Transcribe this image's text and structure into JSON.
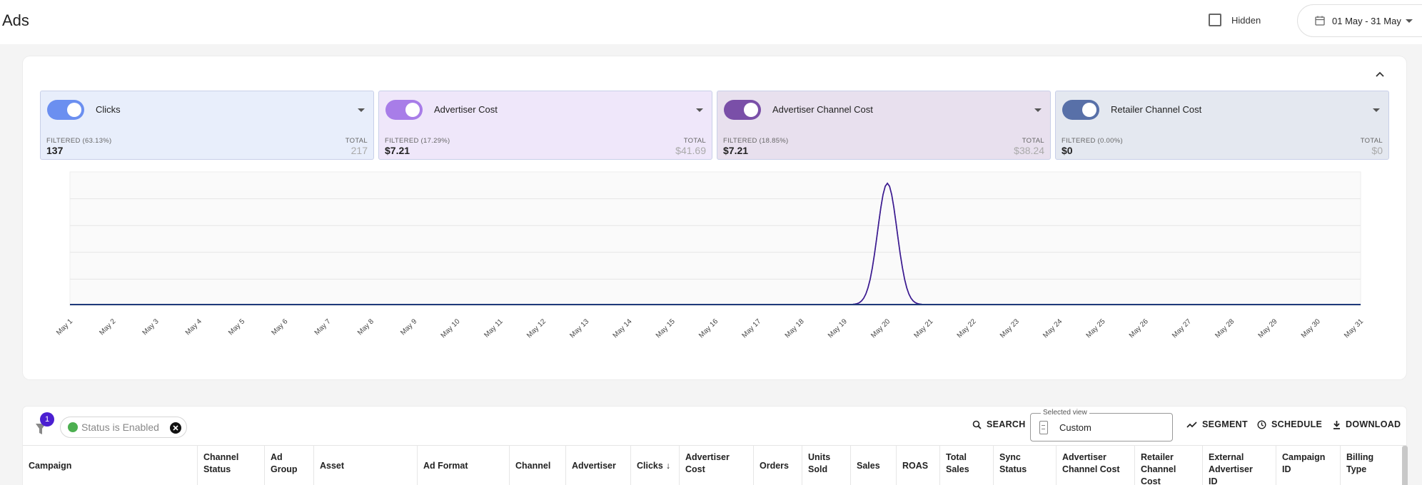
{
  "header": {
    "title": "Ads",
    "hidden_label": "Hidden",
    "date_range": "01 May - 31 May"
  },
  "metrics": [
    {
      "name": "Clicks",
      "filtered_label": "FILTERED (63.13%)",
      "filtered_value": "137",
      "total_label": "TOTAL",
      "total_value": "217",
      "color": "#6b8ff0",
      "bg": "#e8eefb"
    },
    {
      "name": "Advertiser Cost",
      "filtered_label": "FILTERED (17.29%)",
      "filtered_value": "$7.21",
      "total_label": "TOTAL",
      "total_value": "$41.69",
      "color": "#a87de8",
      "bg": "#efe7fa"
    },
    {
      "name": "Advertiser Channel Cost",
      "filtered_label": "FILTERED (18.85%)",
      "filtered_value": "$7.21",
      "total_label": "TOTAL",
      "total_value": "$38.24",
      "color": "#7a4fa8",
      "bg": "#e8e0ee"
    },
    {
      "name": "Retailer Channel Cost",
      "filtered_label": "FILTERED (0.00%)",
      "filtered_value": "$0",
      "total_label": "TOTAL",
      "total_value": "$0",
      "color": "#5870a8",
      "bg": "#e4e8f0"
    }
  ],
  "chart_data": {
    "type": "line",
    "title": "",
    "xlabel": "",
    "ylabel": "",
    "grid": true,
    "categories": [
      "May 1",
      "May 2",
      "May 3",
      "May 4",
      "May 5",
      "May 6",
      "May 7",
      "May 8",
      "May 9",
      "May 10",
      "May 11",
      "May 12",
      "May 13",
      "May 14",
      "May 15",
      "May 16",
      "May 17",
      "May 18",
      "May 19",
      "May 20",
      "May 21",
      "May 22",
      "May 23",
      "May 24",
      "May 25",
      "May 26",
      "May 27",
      "May 28",
      "May 29",
      "May 30",
      "May 31"
    ],
    "series": [
      {
        "color": "#6b8ff0",
        "values": [
          0,
          0,
          0,
          0,
          0,
          0,
          0,
          0,
          0,
          0,
          0,
          0,
          0,
          0,
          0,
          0,
          0,
          0,
          0,
          137,
          0,
          0,
          0,
          0,
          0,
          0,
          0,
          0,
          0,
          0,
          0
        ]
      },
      {
        "color": "#a87de8",
        "values": [
          0,
          0,
          0,
          0,
          0,
          0,
          0,
          0,
          0,
          0,
          0,
          0,
          0,
          0,
          0,
          0,
          0,
          0,
          0,
          7.21,
          0,
          0,
          0,
          0,
          0,
          0,
          0,
          0,
          0,
          0,
          0
        ]
      },
      {
        "color": "#3b1a8a",
        "values": [
          0,
          0,
          0,
          0,
          0,
          0,
          0,
          0,
          0,
          0,
          0,
          0,
          0,
          0,
          0,
          0,
          0,
          0,
          0,
          7.21,
          0,
          0,
          0,
          0,
          0,
          0,
          0,
          0,
          0,
          0,
          0
        ]
      },
      {
        "color": "#1f3a7a",
        "values": [
          0,
          0,
          0,
          0,
          0,
          0,
          0,
          0,
          0,
          0,
          0,
          0,
          0,
          0,
          0,
          0,
          0,
          0,
          0,
          0,
          0,
          0,
          0,
          0,
          0,
          0,
          0,
          0,
          0,
          0,
          0
        ]
      }
    ]
  },
  "table_toolbar": {
    "filter_count": "1",
    "filter_chip": "Status is Enabled",
    "search_label": "SEARCH",
    "view_legend": "Selected view",
    "view_value": "Custom",
    "segment_label": "SEGMENT",
    "schedule_label": "SCHEDULE",
    "download_label": "DOWNLOAD"
  },
  "table": {
    "columns": [
      "Campaign",
      "Channel\nStatus",
      "Ad\nGroup",
      "Asset",
      "Ad Format",
      "Channel",
      "Advertiser",
      "Clicks",
      "Advertiser\nCost",
      "Orders",
      "Units\nSold",
      "Sales",
      "ROAS",
      "Total\nSales",
      "Sync\nStatus",
      "Advertiser\nChannel Cost",
      "Retailer\nChannel\nCost",
      "External\nAdvertiser\nID",
      "Campaign\nID",
      "Billing\nType"
    ],
    "sort_indicator": "↓"
  }
}
